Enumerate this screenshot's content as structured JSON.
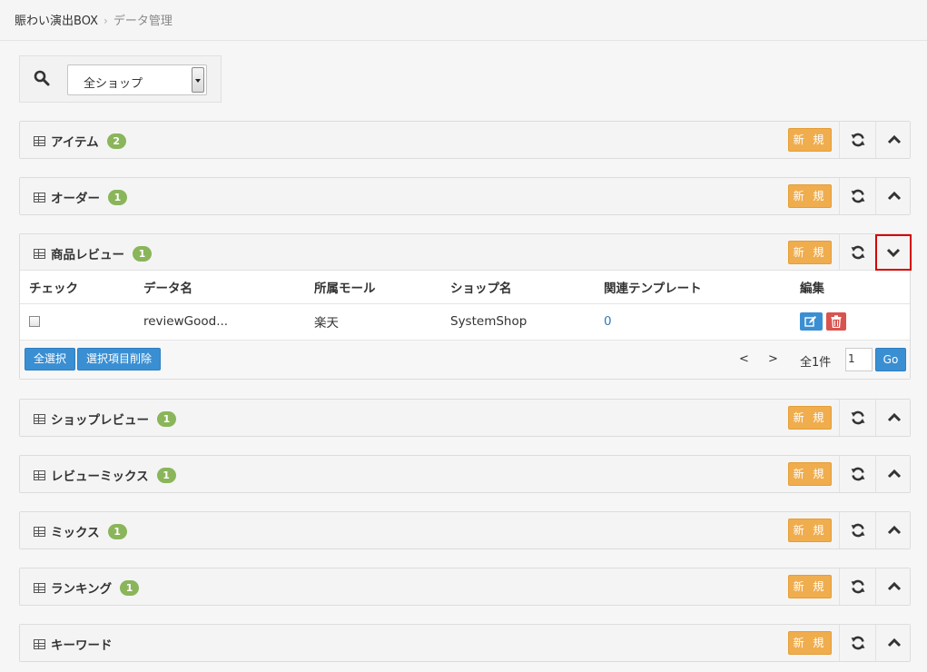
{
  "breadcrumb": {
    "home": "賑わい演出BOX",
    "separator": "›",
    "current": "データ管理"
  },
  "filter": {
    "select_value": "全ショップ"
  },
  "buttons": {
    "new_label": "新 規"
  },
  "panels": [
    {
      "title": "アイテム",
      "badge": "2"
    },
    {
      "title": "オーダー",
      "badge": "1"
    },
    {
      "title": "商品レビュー",
      "badge": "1"
    },
    {
      "title": "ショップレビュー",
      "badge": "1"
    },
    {
      "title": "レビューミックス",
      "badge": "1"
    },
    {
      "title": "ミックス",
      "badge": "1"
    },
    {
      "title": "ランキング",
      "badge": "1"
    },
    {
      "title": "キーワード",
      "badge": ""
    }
  ],
  "review_table": {
    "columns": [
      "チェック",
      "データ名",
      "所属モール",
      "ショップ名",
      "関連テンプレート",
      "編集"
    ],
    "rows": [
      {
        "data_name": "reviewGood...",
        "mall": "楽天",
        "shop": "SystemShop",
        "templates": "0"
      }
    ],
    "footer": {
      "select_all": "全選択",
      "delete_selected": "選択項目削除",
      "prev": "<",
      "next": ">",
      "total": "全1件",
      "page": "1",
      "go": "Go"
    }
  },
  "colors": {
    "accent": "#3a8fd3",
    "new_button": "#f0ad4e",
    "badge": "#8ab55a",
    "delete": "#d9534f",
    "highlight": "#d40000"
  }
}
